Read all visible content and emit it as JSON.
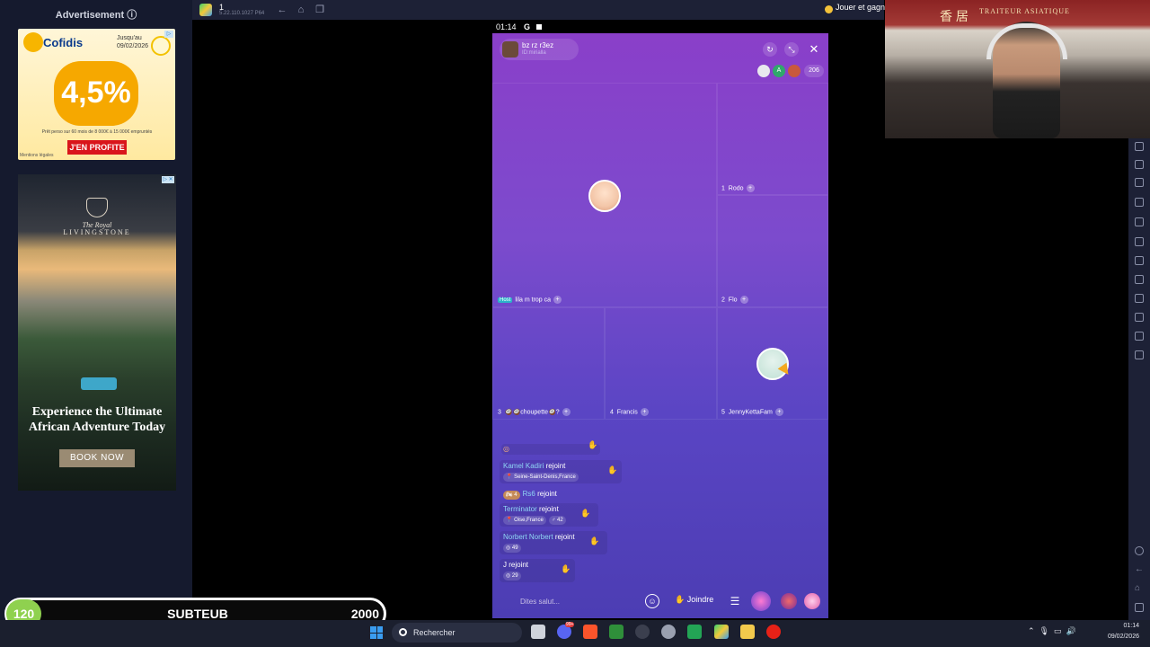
{
  "ads": {
    "header": "Advertisement ⓘ",
    "cofidis": {
      "brand": "Cofidis",
      "date_line1": "Jusqu'au",
      "date_line2": "09/02/2026",
      "rate": "4,5%",
      "fine_print": "Prêt perso sur 60 mois de 8 000€ à 15 000€ empruntés",
      "cta": "J'EN PROFITE",
      "legal": "Mentions légales"
    },
    "livingstone": {
      "hotel_line1": "The Royal",
      "hotel_line2": "LIVINGSTONE",
      "headline": "Experience the Ultimate African Adventure Today",
      "cta": "BOOK NOW"
    }
  },
  "emulator": {
    "title": "1",
    "version": "5.22.110.1027 P64",
    "promo": "Jouer et gagn"
  },
  "phone": {
    "status_time": "01:14",
    "status_g": "G",
    "room": {
      "name": "bz rz r3ez",
      "id": "ID:mirialla"
    },
    "viewer_count": "206",
    "viewer_badge_letter": "A",
    "seats": [
      {
        "tag": "Host",
        "name": "lila m trop ca"
      },
      {
        "number": "1",
        "name": "Rodo"
      },
      {
        "number": "2",
        "name": "Flo"
      },
      {
        "number": "3",
        "name": "🥥🥥choupette🥥?"
      },
      {
        "number": "4",
        "name": "Francis"
      },
      {
        "number": "5",
        "name": "JennyKettaFam"
      }
    ],
    "chat": [
      {
        "name": "Kamel Kadiri",
        "action": "rejoint",
        "location": "Seine-Saint-Denis,France"
      },
      {
        "badge": "4",
        "name": "Rs6",
        "action": "rejoint"
      },
      {
        "name": "Terminator",
        "action": "rejoint",
        "location": "Oise,France",
        "age": "♂ 42"
      },
      {
        "name": "Norbert Norbert",
        "action": "rejoint",
        "stat": "49"
      },
      {
        "name": "J",
        "action": "rejoint",
        "stat": "29"
      }
    ],
    "input_placeholder": "Dites salut...",
    "join_label": "Joindre"
  },
  "webcam": {
    "sign_chinese": "香 居",
    "sign_text": "TRAITEUR ASIATIQUE"
  },
  "stream_counter": {
    "current": "120",
    "label": "SUBTEUB",
    "goal": "2000"
  },
  "taskbar": {
    "search_placeholder": "Rechercher",
    "time": "01:14",
    "date": "09/02/2026",
    "discord_badge": "99+"
  },
  "colors": {
    "phone_top": "#8a3fc9",
    "phone_bottom": "#4c3db3",
    "counter_badge": "#8fd14f",
    "chat_name": "#8fd6f5"
  }
}
